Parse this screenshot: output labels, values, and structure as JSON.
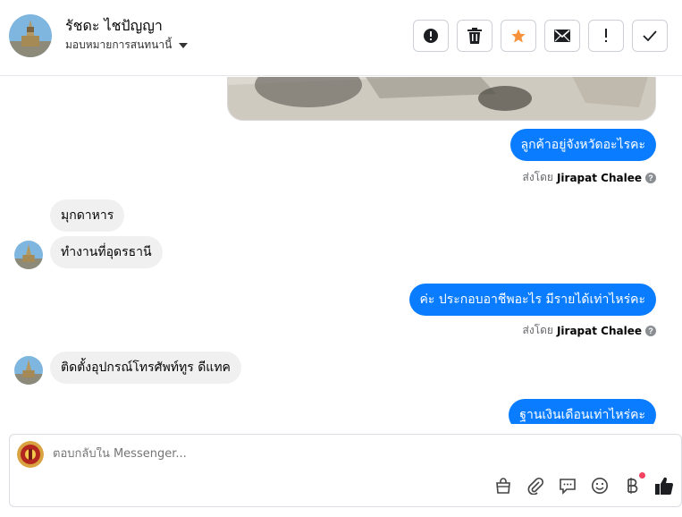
{
  "header": {
    "contact_name": "รัชดะ ไชปัญญา",
    "assign_label": "มอบหมายการสนทนานี้",
    "tools": [
      {
        "name": "spam-button",
        "icon": "alert-circle-icon"
      },
      {
        "name": "delete-button",
        "icon": "trash-icon"
      },
      {
        "name": "star-button",
        "icon": "star-icon"
      },
      {
        "name": "mark-unread-button",
        "icon": "envelope-icon"
      },
      {
        "name": "follow-up-button",
        "icon": "exclamation-icon"
      },
      {
        "name": "mark-done-button",
        "icon": "check-icon"
      }
    ]
  },
  "messages": [
    {
      "dir": "out",
      "text": "ลูกค้าอยู่จังหวัดอะไรคะ"
    },
    {
      "dir": "in",
      "text": "มุกดาหาร"
    },
    {
      "dir": "in",
      "text": "ทำงานที่อุดรธานี"
    },
    {
      "dir": "out",
      "text": "ค่ะ ประกอบอาชีพอะไร มีรายได้เท่าไหร่คะ"
    },
    {
      "dir": "in",
      "text": "ติดตั้งอุปกรณ์โทรศัพท์ทูร ดีแทค"
    },
    {
      "dir": "out",
      "text": "ฐานเงินเดือนเท่าไหร่คะ"
    }
  ],
  "sent_by": {
    "prefix": "ส่งโดย",
    "name": "Jirapat Chalee",
    "help": "?"
  },
  "composer": {
    "placeholder": "ตอบกลับใน Messenger...",
    "icons": [
      "shopping-bag-icon",
      "paperclip-icon",
      "saved-reply-icon",
      "emoji-icon",
      "baht-payment-icon",
      "thumbs-up-icon"
    ]
  },
  "colors": {
    "accent": "#0a7cff",
    "incoming": "#f0f0f0",
    "star": "#f7923a",
    "notification": "#f3425f"
  }
}
